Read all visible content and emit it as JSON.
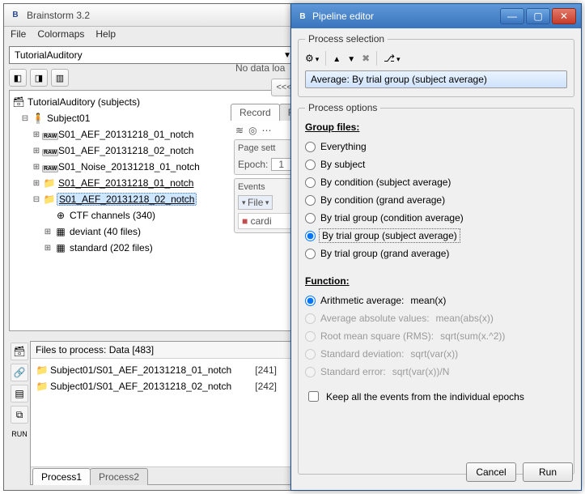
{
  "main": {
    "title": "Brainstorm 3.2",
    "menu": [
      "File",
      "Colormaps",
      "Help"
    ],
    "protocol": "TutorialAuditory",
    "toolbar_icons": [
      "subjects-view-icon",
      "studies-view-icon",
      "display-icon"
    ],
    "tree": {
      "root": "TutorialAuditory (subjects)",
      "subject": "Subject01",
      "items": [
        {
          "label": "S01_AEF_20131218_01_notch",
          "type": "raw"
        },
        {
          "label": "S01_AEF_20131218_02_notch",
          "type": "raw"
        },
        {
          "label": "S01_Noise_20131218_01_notch",
          "type": "raw"
        },
        {
          "label": "S01_AEF_20131218_01_notch",
          "type": "folder",
          "link": true
        },
        {
          "label": "S01_AEF_20131218_02_notch",
          "type": "folder",
          "link": true,
          "selected": true,
          "expanded": true
        }
      ],
      "children": [
        {
          "label": "CTF channels (340)",
          "icon": "channels-icon"
        },
        {
          "label": "deviant (40 files)",
          "icon": "group-icon"
        },
        {
          "label": "standard (202 files)",
          "icon": "group-icon"
        }
      ]
    },
    "back": {
      "nodata": "No data loa",
      "nav": [
        "<<<",
        ">>"
      ],
      "tabs": [
        "Record",
        "Fil"
      ],
      "page_sett": "Page sett",
      "epoch": "Epoch:",
      "epoch_val": "1",
      "events": "Events",
      "file_menu": "File",
      "event_item": "cardi"
    },
    "files": {
      "header": "Files to process: Data [483]",
      "rows": [
        {
          "label": "Subject01/S01_AEF_20131218_01_notch",
          "count": "[241]"
        },
        {
          "label": "Subject01/S01_AEF_20131218_02_notch",
          "count": "[242]"
        }
      ],
      "left_icons": [
        "db-icon",
        "link-icon",
        "stack-icon",
        "copy-icon"
      ],
      "run": "RUN",
      "tabs": [
        "Process1",
        "Process2"
      ]
    }
  },
  "dialog": {
    "title": "Pipeline editor",
    "selection_legend": "Process selection",
    "toolbar": {
      "gear": "gear-icon",
      "up": "up-icon",
      "down": "down-icon",
      "del": "delete-icon",
      "fork": "branch-icon"
    },
    "selected_process": "Average: By trial group (subject average)",
    "options_legend": "Process options",
    "group_files_label": "Group files:",
    "group_options": [
      "Everything",
      "By subject",
      "By condition (subject average)",
      "By condition (grand average)",
      "By trial group (condition average)",
      "By trial group (subject average)",
      "By trial group (grand average)"
    ],
    "group_selected_index": 5,
    "function_label": "Function:",
    "function_options": [
      {
        "label": "Arithmetic average:",
        "detail": "mean(x)",
        "enabled": true
      },
      {
        "label": "Average absolute values:",
        "detail": "mean(abs(x))",
        "enabled": false
      },
      {
        "label": "Root mean square (RMS):",
        "detail": "sqrt(sum(x.^2))",
        "enabled": false
      },
      {
        "label": "Standard deviation:",
        "detail": "sqrt(var(x))",
        "enabled": false
      },
      {
        "label": "Standard error:",
        "detail": "sqrt(var(x))/N",
        "enabled": false
      }
    ],
    "function_selected_index": 0,
    "keep_events": "Keep all the events from the individual epochs",
    "buttons": {
      "cancel": "Cancel",
      "run": "Run"
    }
  }
}
